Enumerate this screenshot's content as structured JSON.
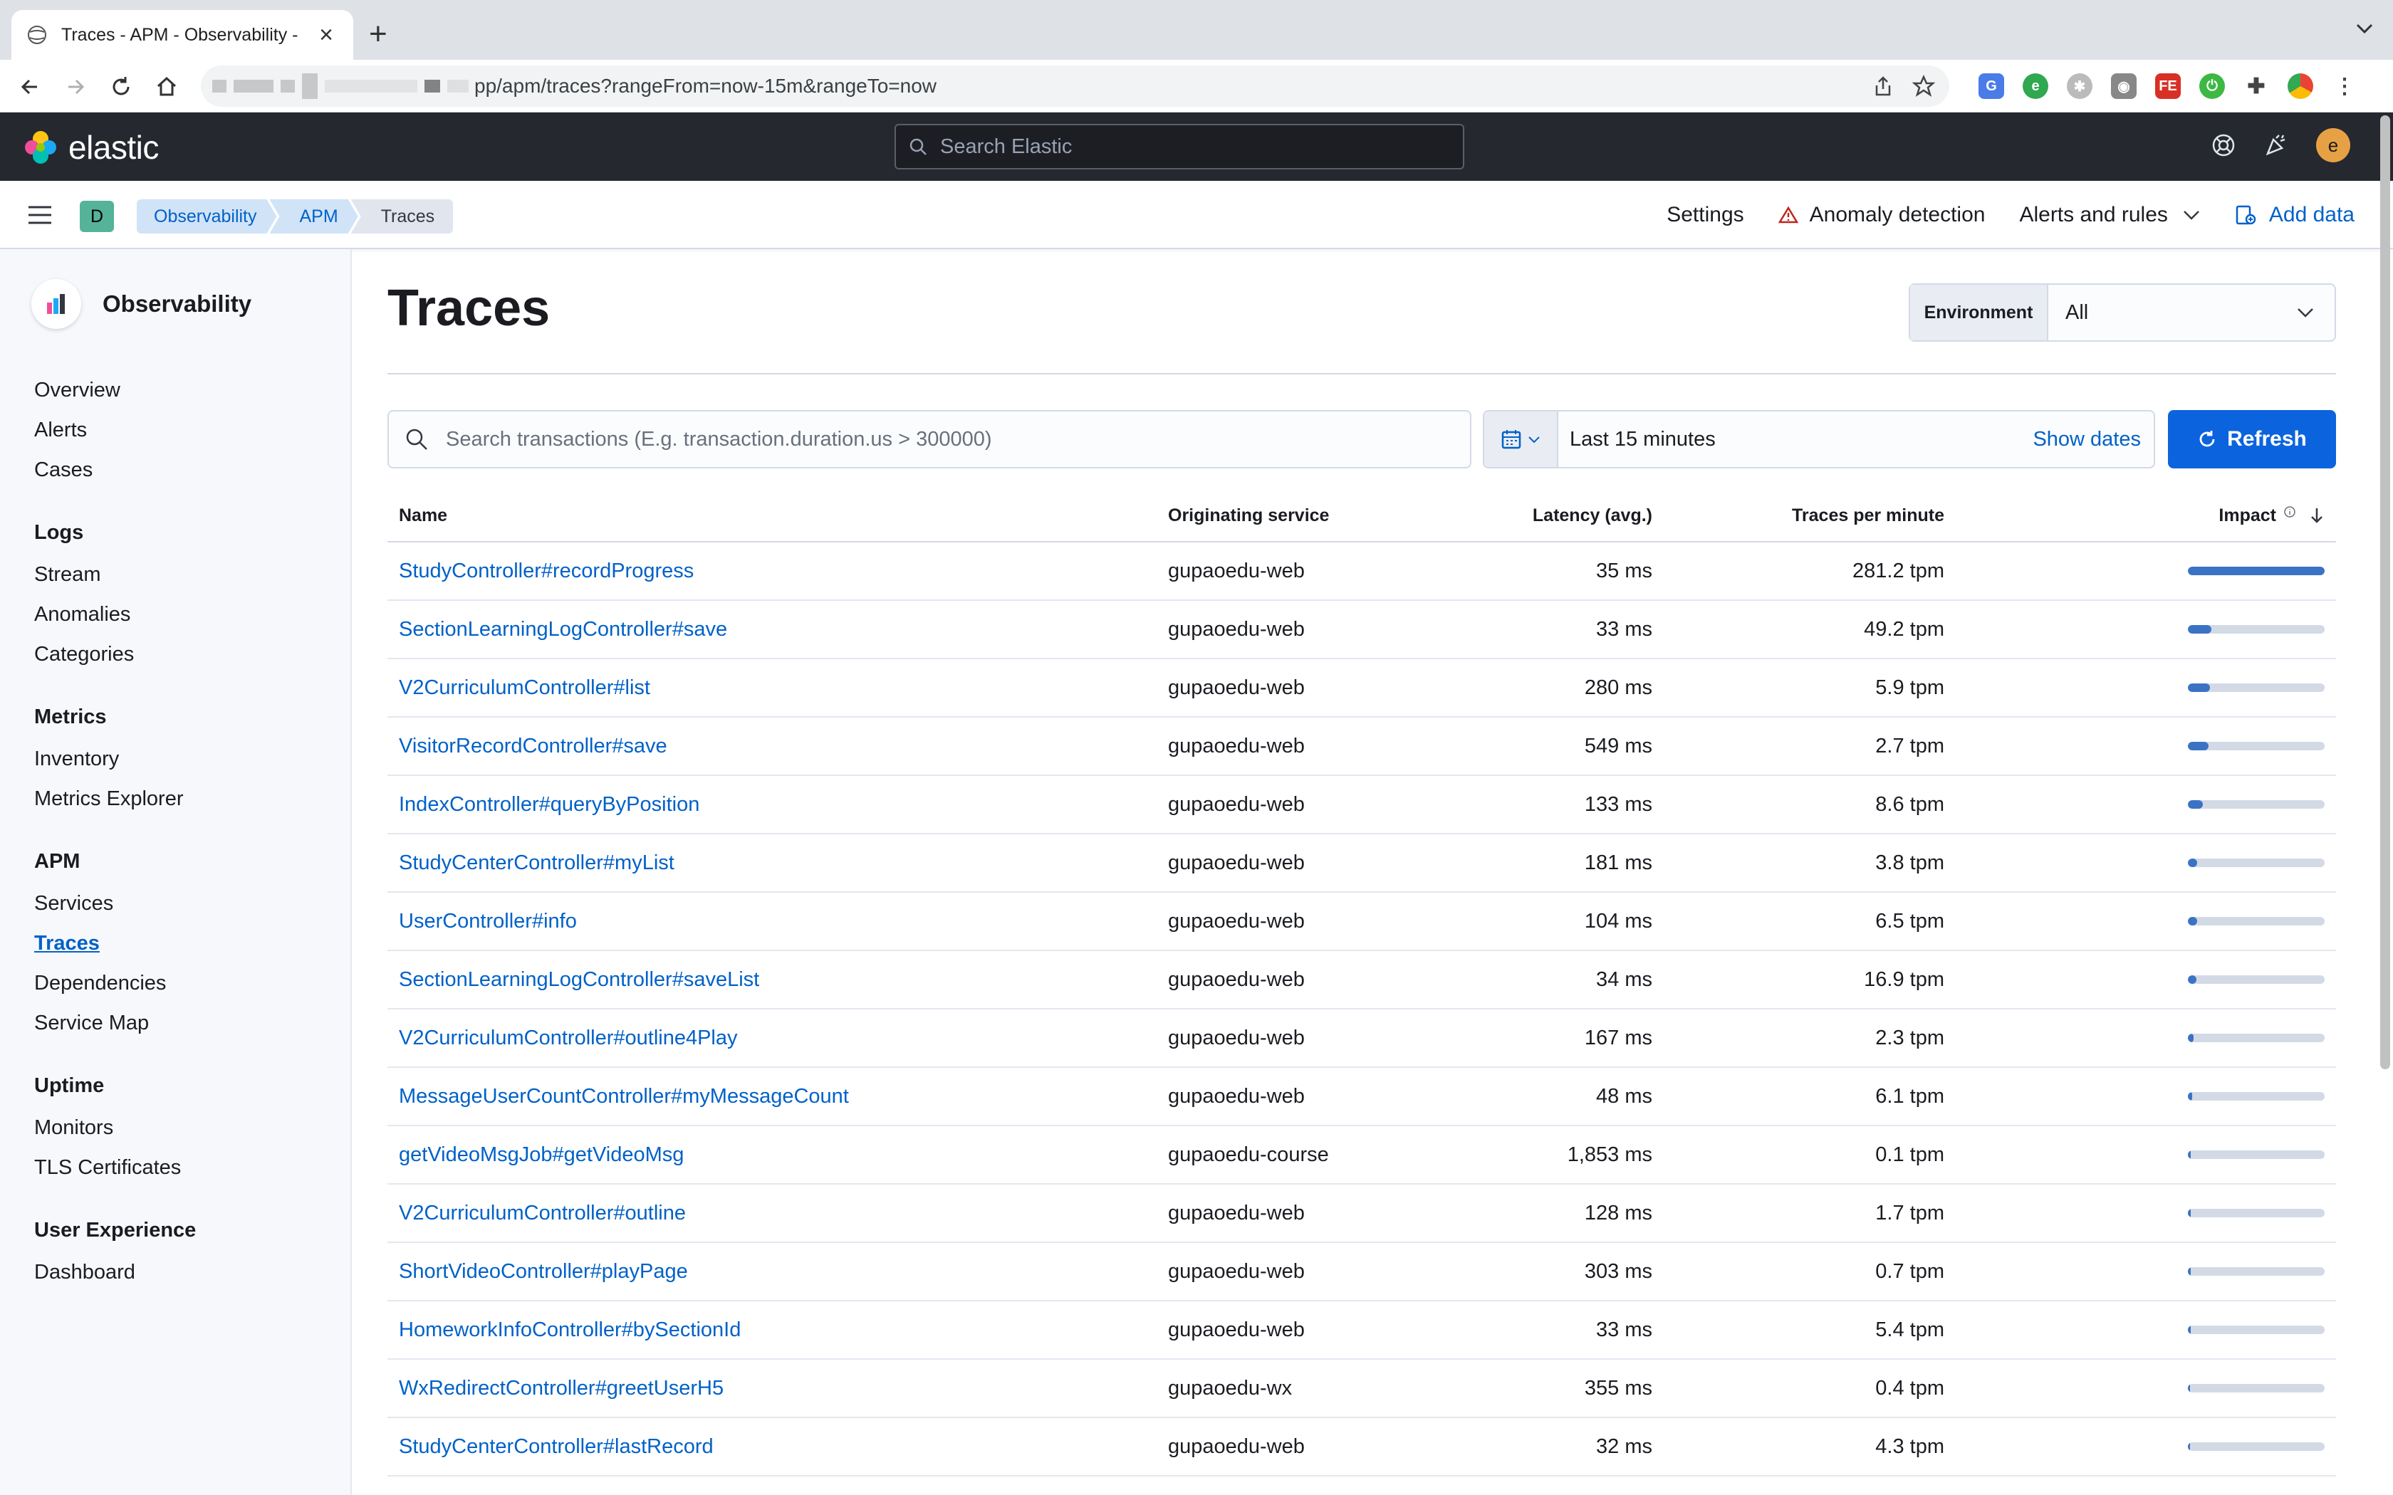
{
  "browser": {
    "tab_title": "Traces - APM - Observability -",
    "url": "pp/apm/traces?rangeFrom=now-15m&rangeTo=now"
  },
  "header": {
    "brand": "elastic",
    "search_placeholder": "Search Elastic",
    "avatar_letter": "e"
  },
  "toolbar": {
    "space_letter": "D",
    "breadcrumbs": [
      "Observability",
      "APM",
      "Traces"
    ],
    "settings": "Settings",
    "anomaly": "Anomaly detection",
    "alerts": "Alerts and rules",
    "add_data": "Add data"
  },
  "sidebar": {
    "title": "Observability",
    "top_items": [
      "Overview",
      "Alerts",
      "Cases"
    ],
    "groups": [
      {
        "title": "Logs",
        "items": [
          "Stream",
          "Anomalies",
          "Categories"
        ]
      },
      {
        "title": "Metrics",
        "items": [
          "Inventory",
          "Metrics Explorer"
        ]
      },
      {
        "title": "APM",
        "items": [
          "Services",
          "Traces",
          "Dependencies",
          "Service Map"
        ]
      },
      {
        "title": "Uptime",
        "items": [
          "Monitors",
          "TLS Certificates"
        ]
      },
      {
        "title": "User Experience",
        "items": [
          "Dashboard"
        ]
      }
    ],
    "active": "Traces"
  },
  "main": {
    "title": "Traces",
    "environment_label": "Environment",
    "environment_value": "All",
    "search_placeholder": "Search transactions (E.g. transaction.duration.us > 300000)",
    "date_range": "Last 15 minutes",
    "show_dates": "Show dates",
    "refresh": "Refresh",
    "columns": [
      "Name",
      "Originating service",
      "Latency (avg.)",
      "Traces per minute",
      "Impact"
    ],
    "rows": [
      {
        "name": "StudyController#recordProgress",
        "service": "gupaoedu-web",
        "latency": "35 ms",
        "tpm": "281.2 tpm",
        "impact": 1.0
      },
      {
        "name": "SectionLearningLogController#save",
        "service": "gupaoedu-web",
        "latency": "33 ms",
        "tpm": "49.2 tpm",
        "impact": 0.17
      },
      {
        "name": "V2CurriculumController#list",
        "service": "gupaoedu-web",
        "latency": "280 ms",
        "tpm": "5.9 tpm",
        "impact": 0.16
      },
      {
        "name": "VisitorRecordController#save",
        "service": "gupaoedu-web",
        "latency": "549 ms",
        "tpm": "2.7 tpm",
        "impact": 0.15
      },
      {
        "name": "IndexController#queryByPosition",
        "service": "gupaoedu-web",
        "latency": "133 ms",
        "tpm": "8.6 tpm",
        "impact": 0.11
      },
      {
        "name": "StudyCenterController#myList",
        "service": "gupaoedu-web",
        "latency": "181 ms",
        "tpm": "3.8 tpm",
        "impact": 0.07
      },
      {
        "name": "UserController#info",
        "service": "gupaoedu-web",
        "latency": "104 ms",
        "tpm": "6.5 tpm",
        "impact": 0.07
      },
      {
        "name": "SectionLearningLogController#saveList",
        "service": "gupaoedu-web",
        "latency": "34 ms",
        "tpm": "16.9 tpm",
        "impact": 0.06
      },
      {
        "name": "V2CurriculumController#outline4Play",
        "service": "gupaoedu-web",
        "latency": "167 ms",
        "tpm": "2.3 tpm",
        "impact": 0.04
      },
      {
        "name": "MessageUserCountController#myMessageCount",
        "service": "gupaoedu-web",
        "latency": "48 ms",
        "tpm": "6.1 tpm",
        "impact": 0.03
      },
      {
        "name": "getVideoMsgJob#getVideoMsg",
        "service": "gupaoedu-course",
        "latency": "1,853 ms",
        "tpm": "0.1 tpm",
        "impact": 0.02
      },
      {
        "name": "V2CurriculumController#outline",
        "service": "gupaoedu-web",
        "latency": "128 ms",
        "tpm": "1.7 tpm",
        "impact": 0.02
      },
      {
        "name": "ShortVideoController#playPage",
        "service": "gupaoedu-web",
        "latency": "303 ms",
        "tpm": "0.7 tpm",
        "impact": 0.02
      },
      {
        "name": "HomeworkInfoController#bySectionId",
        "service": "gupaoedu-web",
        "latency": "33 ms",
        "tpm": "5.4 tpm",
        "impact": 0.02
      },
      {
        "name": "WxRedirectController#greetUserH5",
        "service": "gupaoedu-wx",
        "latency": "355 ms",
        "tpm": "0.4 tpm",
        "impact": 0.015
      },
      {
        "name": "StudyCenterController#lastRecord",
        "service": "gupaoedu-web",
        "latency": "32 ms",
        "tpm": "4.3 tpm",
        "impact": 0.015
      }
    ]
  },
  "colors": {
    "link": "#0061c8",
    "header_bg": "#25282f",
    "primary_button": "#0b64dd",
    "impact_fill": "#3b73c4"
  }
}
